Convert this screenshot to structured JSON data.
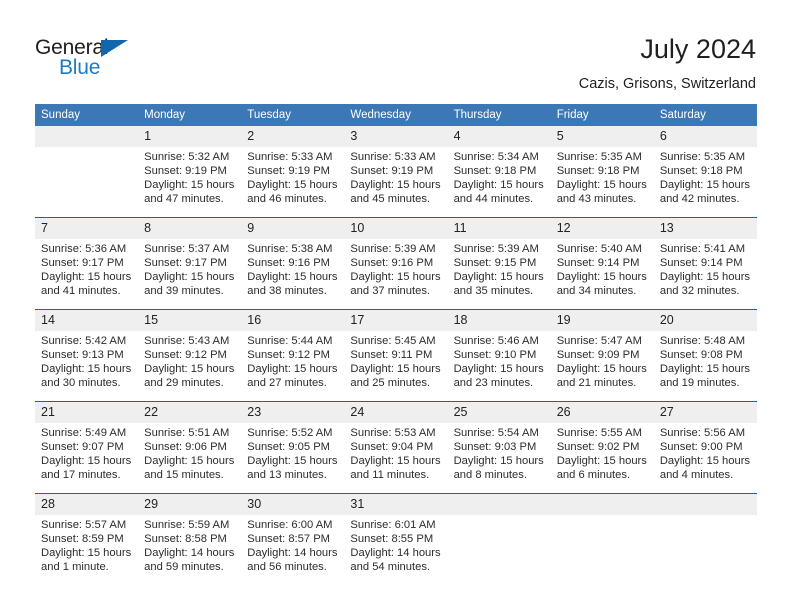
{
  "brand": {
    "name_dark": "General",
    "name_blue": "Blue",
    "triangle_color": "#1266b0",
    "blue_color": "#1e7bc4"
  },
  "header": {
    "title": "July 2024",
    "location": "Cazis, Grisons, Switzerland"
  },
  "theme": {
    "header_blue": "#3b78b5",
    "row_divider_blue": "#2a6099",
    "date_band_gray": "#efefef"
  },
  "weekday_headers": [
    "Sunday",
    "Monday",
    "Tuesday",
    "Wednesday",
    "Thursday",
    "Friday",
    "Saturday"
  ],
  "weeks": [
    [
      {
        "day": "",
        "sunrise": "",
        "sunset": "",
        "daylight_1": "",
        "daylight_2": "",
        "empty": true
      },
      {
        "day": "1",
        "sunrise": "Sunrise: 5:32 AM",
        "sunset": "Sunset: 9:19 PM",
        "daylight_1": "Daylight: 15 hours",
        "daylight_2": "and 47 minutes."
      },
      {
        "day": "2",
        "sunrise": "Sunrise: 5:33 AM",
        "sunset": "Sunset: 9:19 PM",
        "daylight_1": "Daylight: 15 hours",
        "daylight_2": "and 46 minutes."
      },
      {
        "day": "3",
        "sunrise": "Sunrise: 5:33 AM",
        "sunset": "Sunset: 9:19 PM",
        "daylight_1": "Daylight: 15 hours",
        "daylight_2": "and 45 minutes."
      },
      {
        "day": "4",
        "sunrise": "Sunrise: 5:34 AM",
        "sunset": "Sunset: 9:18 PM",
        "daylight_1": "Daylight: 15 hours",
        "daylight_2": "and 44 minutes."
      },
      {
        "day": "5",
        "sunrise": "Sunrise: 5:35 AM",
        "sunset": "Sunset: 9:18 PM",
        "daylight_1": "Daylight: 15 hours",
        "daylight_2": "and 43 minutes."
      },
      {
        "day": "6",
        "sunrise": "Sunrise: 5:35 AM",
        "sunset": "Sunset: 9:18 PM",
        "daylight_1": "Daylight: 15 hours",
        "daylight_2": "and 42 minutes."
      }
    ],
    [
      {
        "day": "7",
        "sunrise": "Sunrise: 5:36 AM",
        "sunset": "Sunset: 9:17 PM",
        "daylight_1": "Daylight: 15 hours",
        "daylight_2": "and 41 minutes."
      },
      {
        "day": "8",
        "sunrise": "Sunrise: 5:37 AM",
        "sunset": "Sunset: 9:17 PM",
        "daylight_1": "Daylight: 15 hours",
        "daylight_2": "and 39 minutes."
      },
      {
        "day": "9",
        "sunrise": "Sunrise: 5:38 AM",
        "sunset": "Sunset: 9:16 PM",
        "daylight_1": "Daylight: 15 hours",
        "daylight_2": "and 38 minutes."
      },
      {
        "day": "10",
        "sunrise": "Sunrise: 5:39 AM",
        "sunset": "Sunset: 9:16 PM",
        "daylight_1": "Daylight: 15 hours",
        "daylight_2": "and 37 minutes."
      },
      {
        "day": "11",
        "sunrise": "Sunrise: 5:39 AM",
        "sunset": "Sunset: 9:15 PM",
        "daylight_1": "Daylight: 15 hours",
        "daylight_2": "and 35 minutes."
      },
      {
        "day": "12",
        "sunrise": "Sunrise: 5:40 AM",
        "sunset": "Sunset: 9:14 PM",
        "daylight_1": "Daylight: 15 hours",
        "daylight_2": "and 34 minutes."
      },
      {
        "day": "13",
        "sunrise": "Sunrise: 5:41 AM",
        "sunset": "Sunset: 9:14 PM",
        "daylight_1": "Daylight: 15 hours",
        "daylight_2": "and 32 minutes."
      }
    ],
    [
      {
        "day": "14",
        "sunrise": "Sunrise: 5:42 AM",
        "sunset": "Sunset: 9:13 PM",
        "daylight_1": "Daylight: 15 hours",
        "daylight_2": "and 30 minutes."
      },
      {
        "day": "15",
        "sunrise": "Sunrise: 5:43 AM",
        "sunset": "Sunset: 9:12 PM",
        "daylight_1": "Daylight: 15 hours",
        "daylight_2": "and 29 minutes."
      },
      {
        "day": "16",
        "sunrise": "Sunrise: 5:44 AM",
        "sunset": "Sunset: 9:12 PM",
        "daylight_1": "Daylight: 15 hours",
        "daylight_2": "and 27 minutes."
      },
      {
        "day": "17",
        "sunrise": "Sunrise: 5:45 AM",
        "sunset": "Sunset: 9:11 PM",
        "daylight_1": "Daylight: 15 hours",
        "daylight_2": "and 25 minutes."
      },
      {
        "day": "18",
        "sunrise": "Sunrise: 5:46 AM",
        "sunset": "Sunset: 9:10 PM",
        "daylight_1": "Daylight: 15 hours",
        "daylight_2": "and 23 minutes."
      },
      {
        "day": "19",
        "sunrise": "Sunrise: 5:47 AM",
        "sunset": "Sunset: 9:09 PM",
        "daylight_1": "Daylight: 15 hours",
        "daylight_2": "and 21 minutes."
      },
      {
        "day": "20",
        "sunrise": "Sunrise: 5:48 AM",
        "sunset": "Sunset: 9:08 PM",
        "daylight_1": "Daylight: 15 hours",
        "daylight_2": "and 19 minutes."
      }
    ],
    [
      {
        "day": "21",
        "sunrise": "Sunrise: 5:49 AM",
        "sunset": "Sunset: 9:07 PM",
        "daylight_1": "Daylight: 15 hours",
        "daylight_2": "and 17 minutes."
      },
      {
        "day": "22",
        "sunrise": "Sunrise: 5:51 AM",
        "sunset": "Sunset: 9:06 PM",
        "daylight_1": "Daylight: 15 hours",
        "daylight_2": "and 15 minutes."
      },
      {
        "day": "23",
        "sunrise": "Sunrise: 5:52 AM",
        "sunset": "Sunset: 9:05 PM",
        "daylight_1": "Daylight: 15 hours",
        "daylight_2": "and 13 minutes."
      },
      {
        "day": "24",
        "sunrise": "Sunrise: 5:53 AM",
        "sunset": "Sunset: 9:04 PM",
        "daylight_1": "Daylight: 15 hours",
        "daylight_2": "and 11 minutes."
      },
      {
        "day": "25",
        "sunrise": "Sunrise: 5:54 AM",
        "sunset": "Sunset: 9:03 PM",
        "daylight_1": "Daylight: 15 hours",
        "daylight_2": "and 8 minutes."
      },
      {
        "day": "26",
        "sunrise": "Sunrise: 5:55 AM",
        "sunset": "Sunset: 9:02 PM",
        "daylight_1": "Daylight: 15 hours",
        "daylight_2": "and 6 minutes."
      },
      {
        "day": "27",
        "sunrise": "Sunrise: 5:56 AM",
        "sunset": "Sunset: 9:00 PM",
        "daylight_1": "Daylight: 15 hours",
        "daylight_2": "and 4 minutes."
      }
    ],
    [
      {
        "day": "28",
        "sunrise": "Sunrise: 5:57 AM",
        "sunset": "Sunset: 8:59 PM",
        "daylight_1": "Daylight: 15 hours",
        "daylight_2": "and 1 minute."
      },
      {
        "day": "29",
        "sunrise": "Sunrise: 5:59 AM",
        "sunset": "Sunset: 8:58 PM",
        "daylight_1": "Daylight: 14 hours",
        "daylight_2": "and 59 minutes."
      },
      {
        "day": "30",
        "sunrise": "Sunrise: 6:00 AM",
        "sunset": "Sunset: 8:57 PM",
        "daylight_1": "Daylight: 14 hours",
        "daylight_2": "and 56 minutes."
      },
      {
        "day": "31",
        "sunrise": "Sunrise: 6:01 AM",
        "sunset": "Sunset: 8:55 PM",
        "daylight_1": "Daylight: 14 hours",
        "daylight_2": "and 54 minutes."
      },
      {
        "day": "",
        "sunrise": "",
        "sunset": "",
        "daylight_1": "",
        "daylight_2": "",
        "empty": true
      },
      {
        "day": "",
        "sunrise": "",
        "sunset": "",
        "daylight_1": "",
        "daylight_2": "",
        "empty": true
      },
      {
        "day": "",
        "sunrise": "",
        "sunset": "",
        "daylight_1": "",
        "daylight_2": "",
        "empty": true
      }
    ]
  ]
}
